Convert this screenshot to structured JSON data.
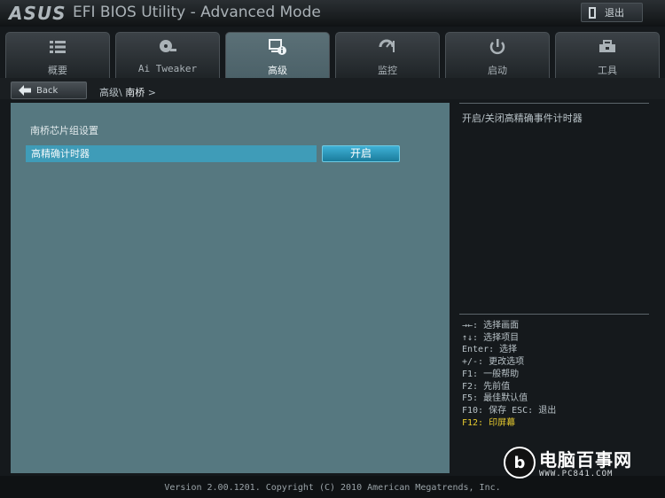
{
  "titlebar": {
    "logo": "ASUS",
    "title": "EFI BIOS Utility - Advanced Mode",
    "exit_label": "退出"
  },
  "tabs": [
    {
      "label": "概要",
      "icon": "list-icon",
      "active": false
    },
    {
      "label": "Ai Tweaker",
      "icon": "fan-icon",
      "active": false
    },
    {
      "label": "高级",
      "icon": "advanced-info-icon",
      "active": true
    },
    {
      "label": "监控",
      "icon": "monitor-icon",
      "active": false
    },
    {
      "label": "启动",
      "icon": "power-icon",
      "active": false
    },
    {
      "label": "工具",
      "icon": "tools-icon",
      "active": false
    }
  ],
  "nav": {
    "back_label": "Back",
    "breadcrumb_parent": "高级\\",
    "breadcrumb_current": "南桥",
    "breadcrumb_arrow": ">"
  },
  "main": {
    "section_title": "南桥芯片组设置",
    "setting_label": "高精确计时器",
    "setting_value": "开启"
  },
  "help": {
    "description": "开启/关闭高精确事件计时器",
    "keys": [
      "→←: 选择画面",
      "↑↓: 选择项目",
      "Enter: 选择",
      "+/-: 更改选项",
      "F1: 一般帮助",
      "F2: 先前值",
      "F5: 最佳默认值",
      "F10: 保存  ESC: 退出"
    ],
    "key_highlight": "F12: 印屏幕"
  },
  "footer": {
    "version": "Version 2.00.1201. Copyright (C) 2010 American Megatrends, Inc."
  },
  "watermark": {
    "title": "电脑百事网",
    "url": "WWW.PC841.COM"
  },
  "colors": {
    "accent": "#3f9cb8",
    "panel": "#567880",
    "highlight_key": "#e7cb2f"
  }
}
